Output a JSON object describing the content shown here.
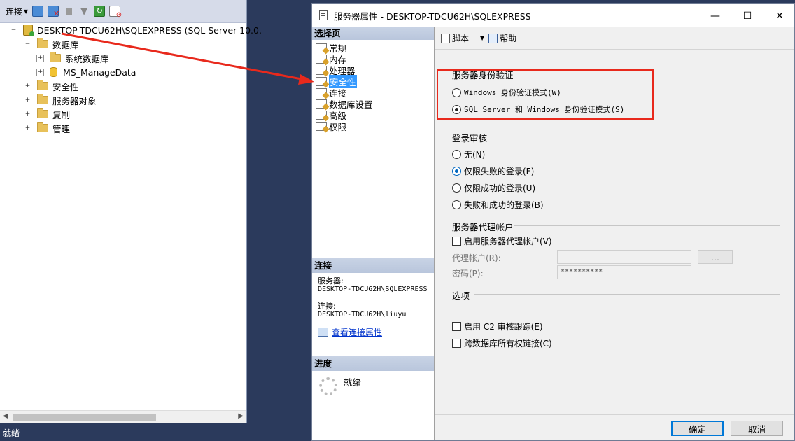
{
  "explorer": {
    "toolbar": {
      "connect_label": "连接",
      "icons": [
        "connect-icon",
        "disconnect-icon",
        "stop-icon",
        "filter-icon",
        "refresh-icon",
        "summary-icon"
      ]
    },
    "tree": {
      "server": "DESKTOP-TDCU62H\\SQLEXPRESS (SQL Server 10.0.",
      "databases": "数据库",
      "system_databases": "系统数据库",
      "db1": "MS_ManageData",
      "security": "安全性",
      "server_objects": "服务器对象",
      "replication": "复制",
      "management": "管理"
    }
  },
  "statusbar": {
    "text": "就绪"
  },
  "dialog": {
    "title": "服务器属性 - DESKTOP-TDCU62H\\SQLEXPRESS",
    "window_buttons": {
      "minimize": "—",
      "maximize": "☐",
      "close": "✕"
    },
    "select_page": {
      "header": "选择页",
      "items": [
        "常规",
        "内存",
        "处理器",
        "安全性",
        "连接",
        "数据库设置",
        "高级",
        "权限"
      ],
      "selected_index": 3
    },
    "connection": {
      "header": "连接",
      "server_label": "服务器:",
      "server_value": "DESKTOP-TDCU62H\\SQLEXPRESS",
      "conn_label": "连接:",
      "conn_value": "DESKTOP-TDCU62H\\liuyu",
      "view_props_link": "查看连接属性"
    },
    "progress": {
      "header": "进度",
      "status": "就绪"
    },
    "toolbar": {
      "script_label": "脚本",
      "help_label": "帮助"
    },
    "auth": {
      "title": "服务器身份验证",
      "options": [
        "Windows 身份验证模式(W)",
        "SQL Server 和 Windows 身份验证模式(S)"
      ],
      "selected_index": 1
    },
    "audit": {
      "title": "登录审核",
      "options": [
        "无(N)",
        "仅限失败的登录(F)",
        "仅限成功的登录(U)",
        "失败和成功的登录(B)"
      ],
      "selected_index": 1
    },
    "proxy": {
      "title": "服务器代理帐户",
      "enable_label": "启用服务器代理帐户(V)",
      "account_label": "代理帐户(R):",
      "account_value": "",
      "browse_label": "...",
      "password_label": "密码(P):",
      "password_value": "**********"
    },
    "options": {
      "title": "选项",
      "c2_label": "启用 C2 审核跟踪(E)",
      "cross_db_label": "跨数据库所有权链接(C)"
    },
    "buttons": {
      "ok": "确定",
      "cancel": "取消"
    },
    "colors": {
      "highlight_box": "#e8291c",
      "selected": "#3399ff",
      "arrow": "#e8291c"
    }
  }
}
